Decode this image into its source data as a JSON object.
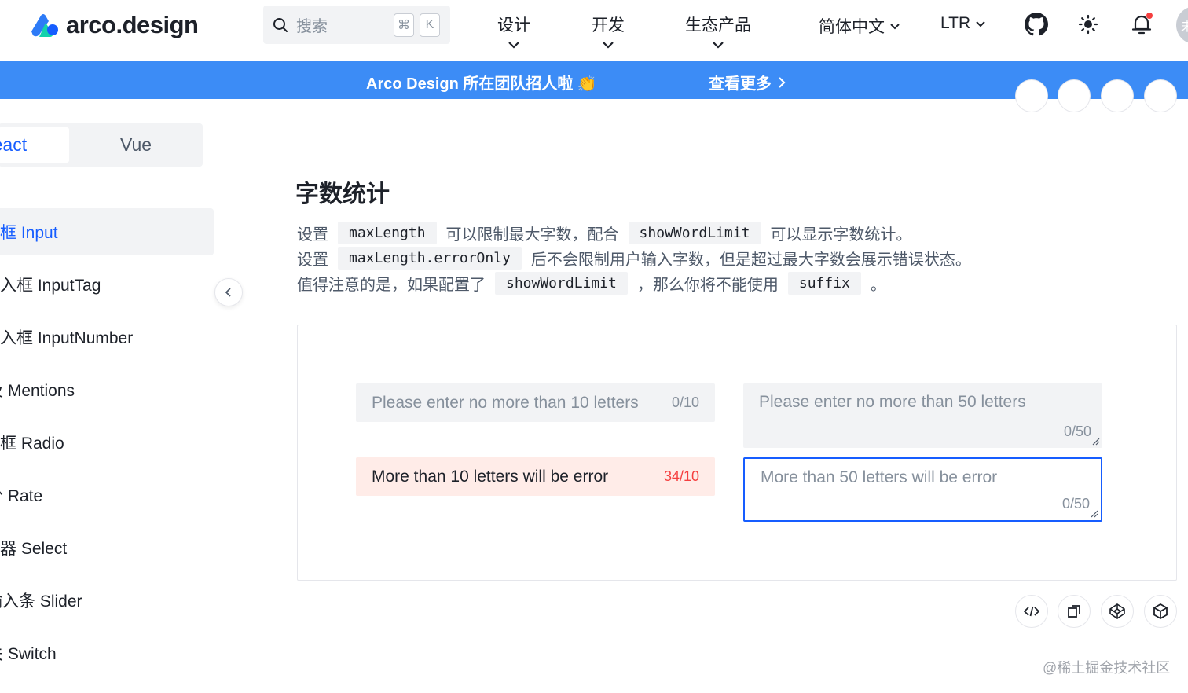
{
  "header": {
    "logo_text": "arco.design",
    "search_placeholder": "搜索",
    "kbd_cmd": "⌘",
    "kbd_k": "K",
    "nav": [
      {
        "label": "设计"
      },
      {
        "label": "开发"
      },
      {
        "label": "生态产品"
      }
    ],
    "language": "简体中文",
    "direction": "LTR",
    "avatar_text": "未"
  },
  "banner": {
    "text": "Arco Design 所在团队招人啦 👏",
    "link": "查看更多"
  },
  "sidebar": {
    "framework_react": "React",
    "framework_vue": "Vue",
    "items": [
      {
        "label": "输入框 Input"
      },
      {
        "label": "标签输入框 InputTag"
      },
      {
        "label": "数字输入框 InputNumber"
      },
      {
        "label": "提及 Mentions"
      },
      {
        "label": "单选框 Radio"
      },
      {
        "label": "评分 Rate"
      },
      {
        "label": "选择器 Select"
      },
      {
        "label": "滑动输入条 Slider"
      },
      {
        "label": "开关 Switch"
      }
    ]
  },
  "main": {
    "title": "字数统计",
    "desc": {
      "l1_a": "设置",
      "l1_code1": "maxLength",
      "l1_b": "可以限制最大字数，配合",
      "l1_code2": "showWordLimit",
      "l1_c": "可以显示字数统计。",
      "l2_a": "设置",
      "l2_code1": "maxLength.errorOnly",
      "l2_b": "后不会限制用户输入字数，但是超过最大字数会展示错误状态。",
      "l3_a": "值得注意的是，如果配置了",
      "l3_code1": "showWordLimit",
      "l3_b": "，那么你将不能使用",
      "l3_code2": "suffix",
      "l3_c": "。"
    },
    "demo": {
      "input1_placeholder": "Please enter no more than 10 letters",
      "input1_count": "0/10",
      "textarea1_placeholder": "Please enter no more than 50 letters",
      "textarea1_count": "0/50",
      "input2_value": "More than 10 letters will be error",
      "input2_count": "34/10",
      "textarea2_placeholder": "More than 50 letters will be error",
      "textarea2_count": "0/50"
    }
  },
  "watermark": "@稀土掘金技术社区",
  "colors": {
    "primary": "#165dff",
    "banner": "#3c8cf6",
    "error": "#f53f3f",
    "error_bg": "#ffece8"
  }
}
